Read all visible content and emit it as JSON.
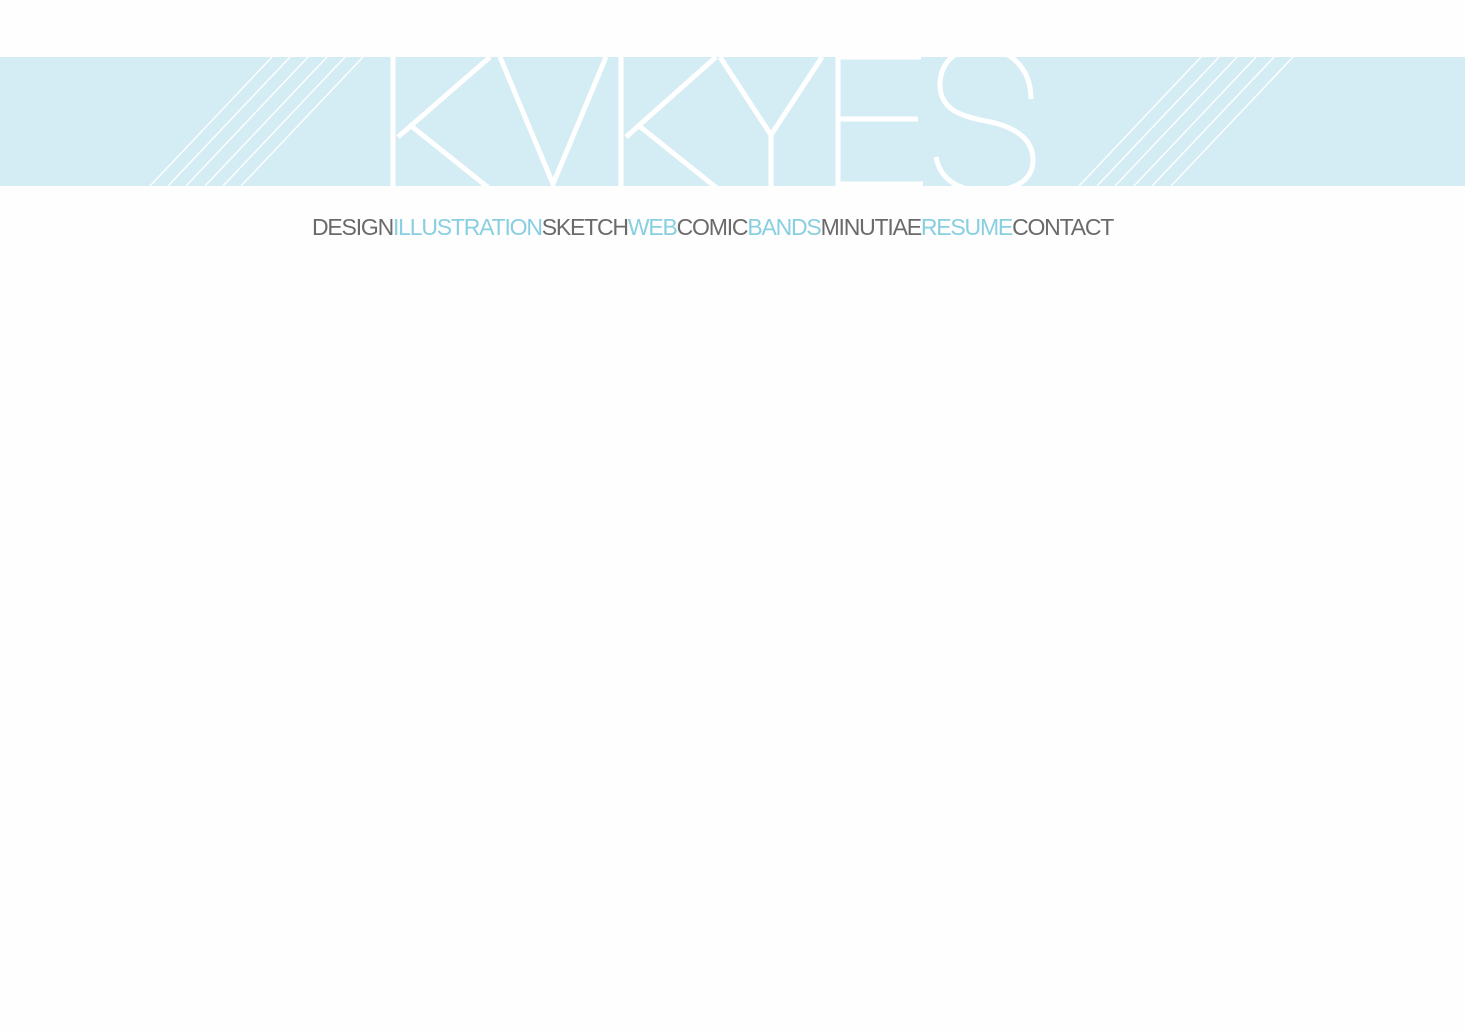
{
  "header": {
    "logo_text": "KVKYES",
    "banner_color": "#d4ecf4",
    "line_color": "#ffffff"
  },
  "nav": {
    "items": [
      {
        "label": "DESIGN",
        "tone": "dark"
      },
      {
        "label": "ILLUSTRATION",
        "tone": "light"
      },
      {
        "label": "SKETCH",
        "tone": "dark"
      },
      {
        "label": "WEB",
        "tone": "light"
      },
      {
        "label": "COMIC",
        "tone": "dark"
      },
      {
        "label": "BANDS",
        "tone": "light"
      },
      {
        "label": "MINUTIAE",
        "tone": "dark"
      },
      {
        "label": "RESUME",
        "tone": "light"
      },
      {
        "label": "CONTACT",
        "tone": "dark"
      }
    ],
    "dark_color": "#6a6a6a",
    "light_color": "#88cfe0"
  }
}
